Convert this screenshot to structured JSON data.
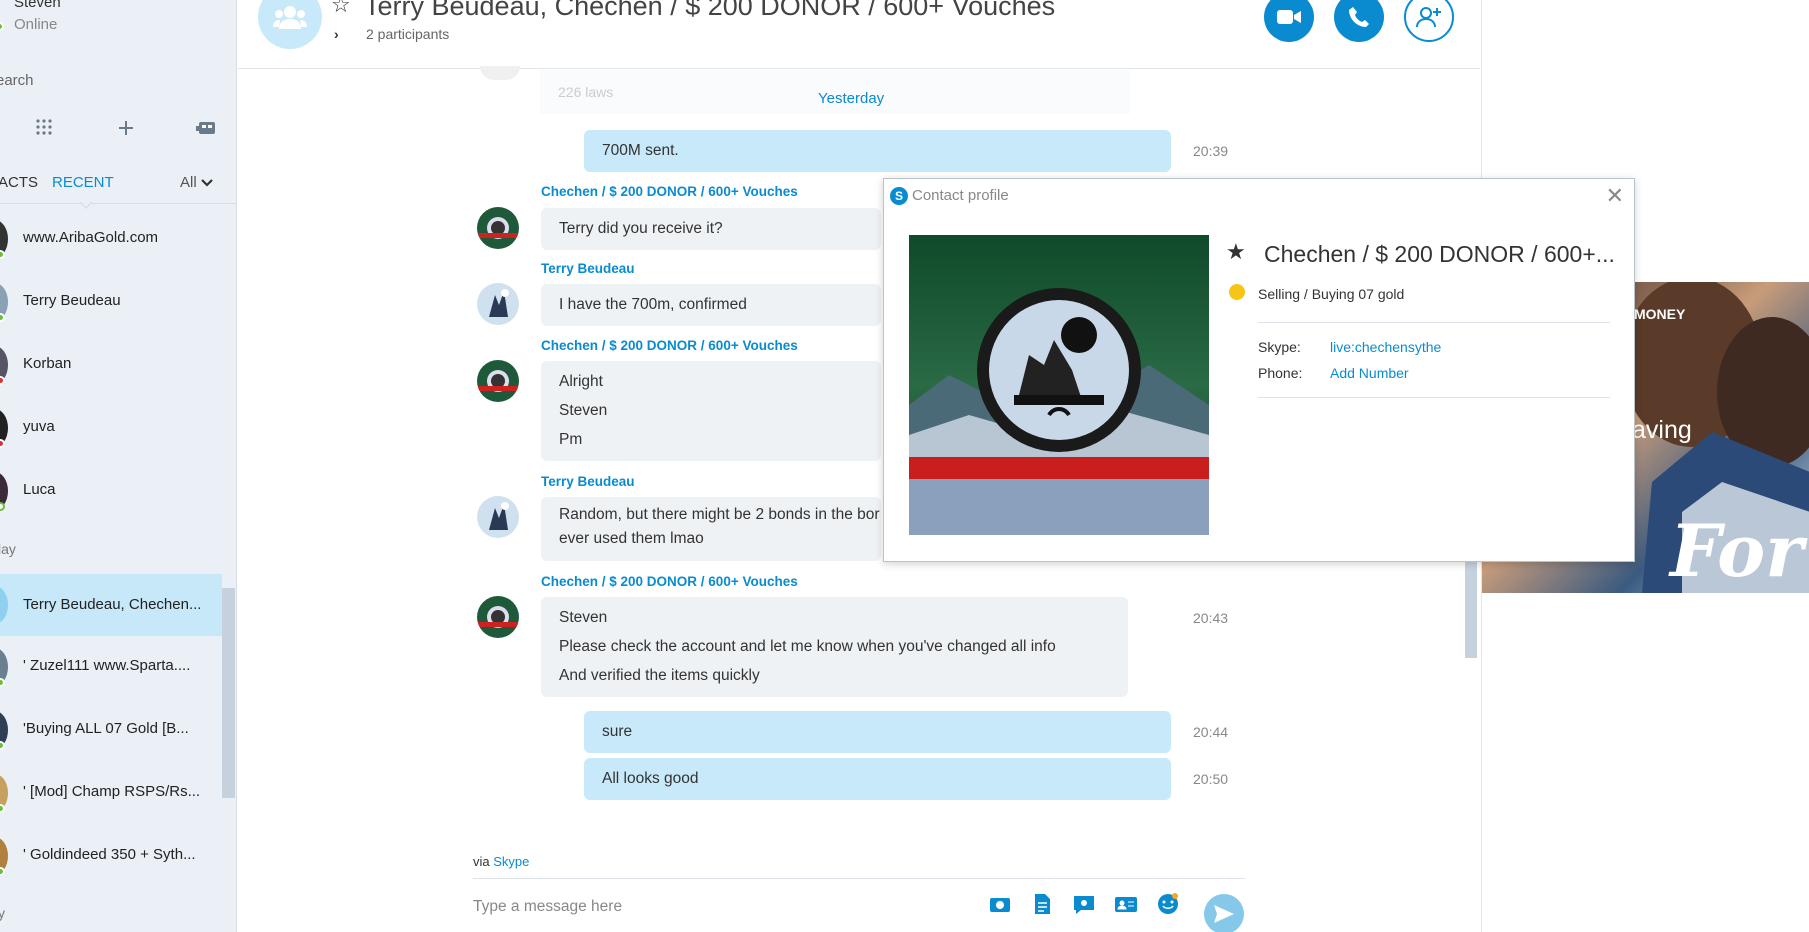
{
  "colors": {
    "accent": "#0a8bd0",
    "bubble_me": "#c7e9fa",
    "bubble_them": "#eef2f5",
    "sidebar_bg": "#eaf0f5"
  },
  "sidebar": {
    "user_name": "Steven",
    "user_status": "Online",
    "search_placeholder": "earch",
    "tools": [
      "dialpad-icon",
      "plus-icon",
      "bot-icon"
    ],
    "tabs": {
      "contacts": "ACTS",
      "recent": "RECENT",
      "filter": "All"
    },
    "contacts": [
      {
        "name": "www.AribaGold.com"
      },
      {
        "name": "Terry Beudeau"
      },
      {
        "name": "Korban"
      },
      {
        "name": "yuva"
      },
      {
        "name": "Luca"
      }
    ],
    "section_today": "lay",
    "recent": [
      {
        "name": "Terry Beudeau, Chechen..."
      },
      {
        "name": "' Zuzel111  www.Sparta...."
      },
      {
        "name": "'Buying ALL 07 Gold [B..."
      },
      {
        "name": "' [Mod] Champ RSPS/Rs..."
      },
      {
        "name": "' Goldindeed 350 + Syth..."
      }
    ],
    "section_bottom": "y"
  },
  "header": {
    "title": "Terry Beudeau, Chechen / $ 200 DONOR / 600+ Vouches",
    "participants": "2 participants"
  },
  "conversation": {
    "faded_text": "226 laws",
    "day_separator": "Yesterday",
    "messages": [
      {
        "from": "me",
        "lines": [
          "700M sent."
        ],
        "time": "20:39"
      },
      {
        "sender": "Chechen / $ 200 DONOR / 600+ Vouches",
        "lines": [
          "Terry did you receive it?"
        ]
      },
      {
        "sender": "Terry Beudeau",
        "lines": [
          "I have the 700m, confirmed"
        ]
      },
      {
        "sender": "Chechen / $ 200 DONOR / 600+ Vouches",
        "lines": [
          "Alright",
          "Steven",
          "Pm"
        ]
      },
      {
        "sender": "Terry Beudeau",
        "lines": [
          "Random, but there might be 2 bonds in the bor",
          "ever used them lmao"
        ]
      },
      {
        "sender": "Chechen / $ 200 DONOR / 600+ Vouches",
        "lines": [
          "Steven",
          "Please check the account and let me know when you've changed all info",
          "And verified the items quickly"
        ],
        "time": "20:43"
      },
      {
        "from": "me",
        "lines": [
          "sure"
        ],
        "time": "20:44"
      },
      {
        "from": "me",
        "lines": [
          "All looks good"
        ],
        "time": "20:50"
      }
    ],
    "via_prefix": "via",
    "via_link": "Skype",
    "composer_placeholder": "Type a message here"
  },
  "ad": {
    "text1": "MONEY",
    "text2": "aving",
    "logo": "For"
  },
  "profile_dialog": {
    "title": "Contact profile",
    "name": "Chechen / $ 200 DONOR / 600+...",
    "mood": "Selling / Buying 07 gold",
    "skype_label": "Skype:",
    "skype_value": "live:chechensythe",
    "phone_label": "Phone:",
    "phone_value": "Add Number"
  }
}
